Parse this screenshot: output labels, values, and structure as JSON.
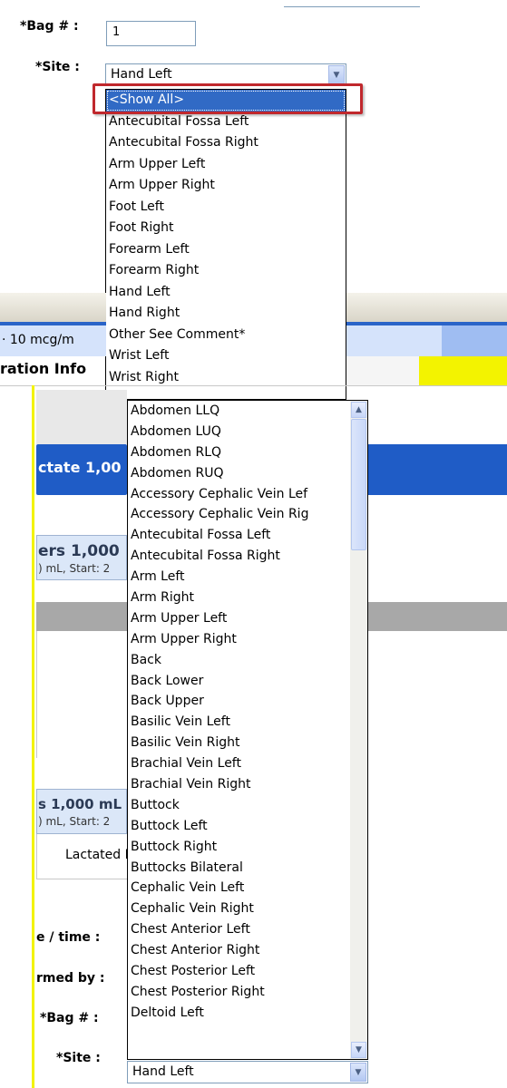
{
  "top_form": {
    "bag_label": "*Bag # :",
    "bag_value": "1",
    "site_label": "*Site :",
    "site_value": "Hand Left",
    "site_options": [
      "<Show All>",
      "Antecubital Fossa Left",
      "Antecubital Fossa Right",
      "Arm Upper Left",
      "Arm Upper Right",
      "Foot Left",
      "Foot Right",
      "Forearm Left",
      "Forearm Right",
      "Hand Left",
      "Hand Right",
      "Other See Comment*",
      "Wrist Left",
      "Wrist Right"
    ]
  },
  "background": {
    "dose_fragment": "· 10 mcg/m",
    "section_fragment": "ration Info",
    "order1_fragment": "ctate 1,00",
    "order2_title_fragment": "ers 1,000",
    "order2_sub_fragment": ") mL, Start: 2",
    "order3_title_fragment": "s 1,000 mL",
    "order3_sub_fragment": ") mL, Start: 2",
    "lactated_fragment": "Lactated R",
    "datetime_label": "e / time :",
    "performed_label": "rmed by :",
    "bag_label": "*Bag # :",
    "site_label": "*Site :",
    "site_value": "Hand Left"
  },
  "show_all_list": {
    "options": [
      "Abdomen LLQ",
      "Abdomen LUQ",
      "Abdomen RLQ",
      "Abdomen RUQ",
      "Accessory Cephalic Vein Lef",
      "Accessory Cephalic Vein Rig",
      "Antecubital Fossa Left",
      "Antecubital Fossa Right",
      "Arm Left",
      "Arm Right",
      "Arm Upper Left",
      "Arm Upper Right",
      "Back",
      "Back Lower",
      "Back Upper",
      "Basilic Vein Left",
      "Basilic Vein Right",
      "Brachial Vein Left",
      "Brachial Vein Right",
      "Buttock",
      "Buttock Left",
      "Buttock Right",
      "Buttocks Bilateral",
      "Cephalic Vein Left",
      "Cephalic Vein Right",
      "Chest Anterior Left",
      "Chest Anterior Right",
      "Chest Posterior Left",
      "Chest Posterior Right",
      "Deltoid Left"
    ]
  },
  "colors": {
    "highlight_box": "#c0282d",
    "selection": "#316ac5",
    "yellow": "#f3f300",
    "header_blue": "#1f5cc6"
  }
}
